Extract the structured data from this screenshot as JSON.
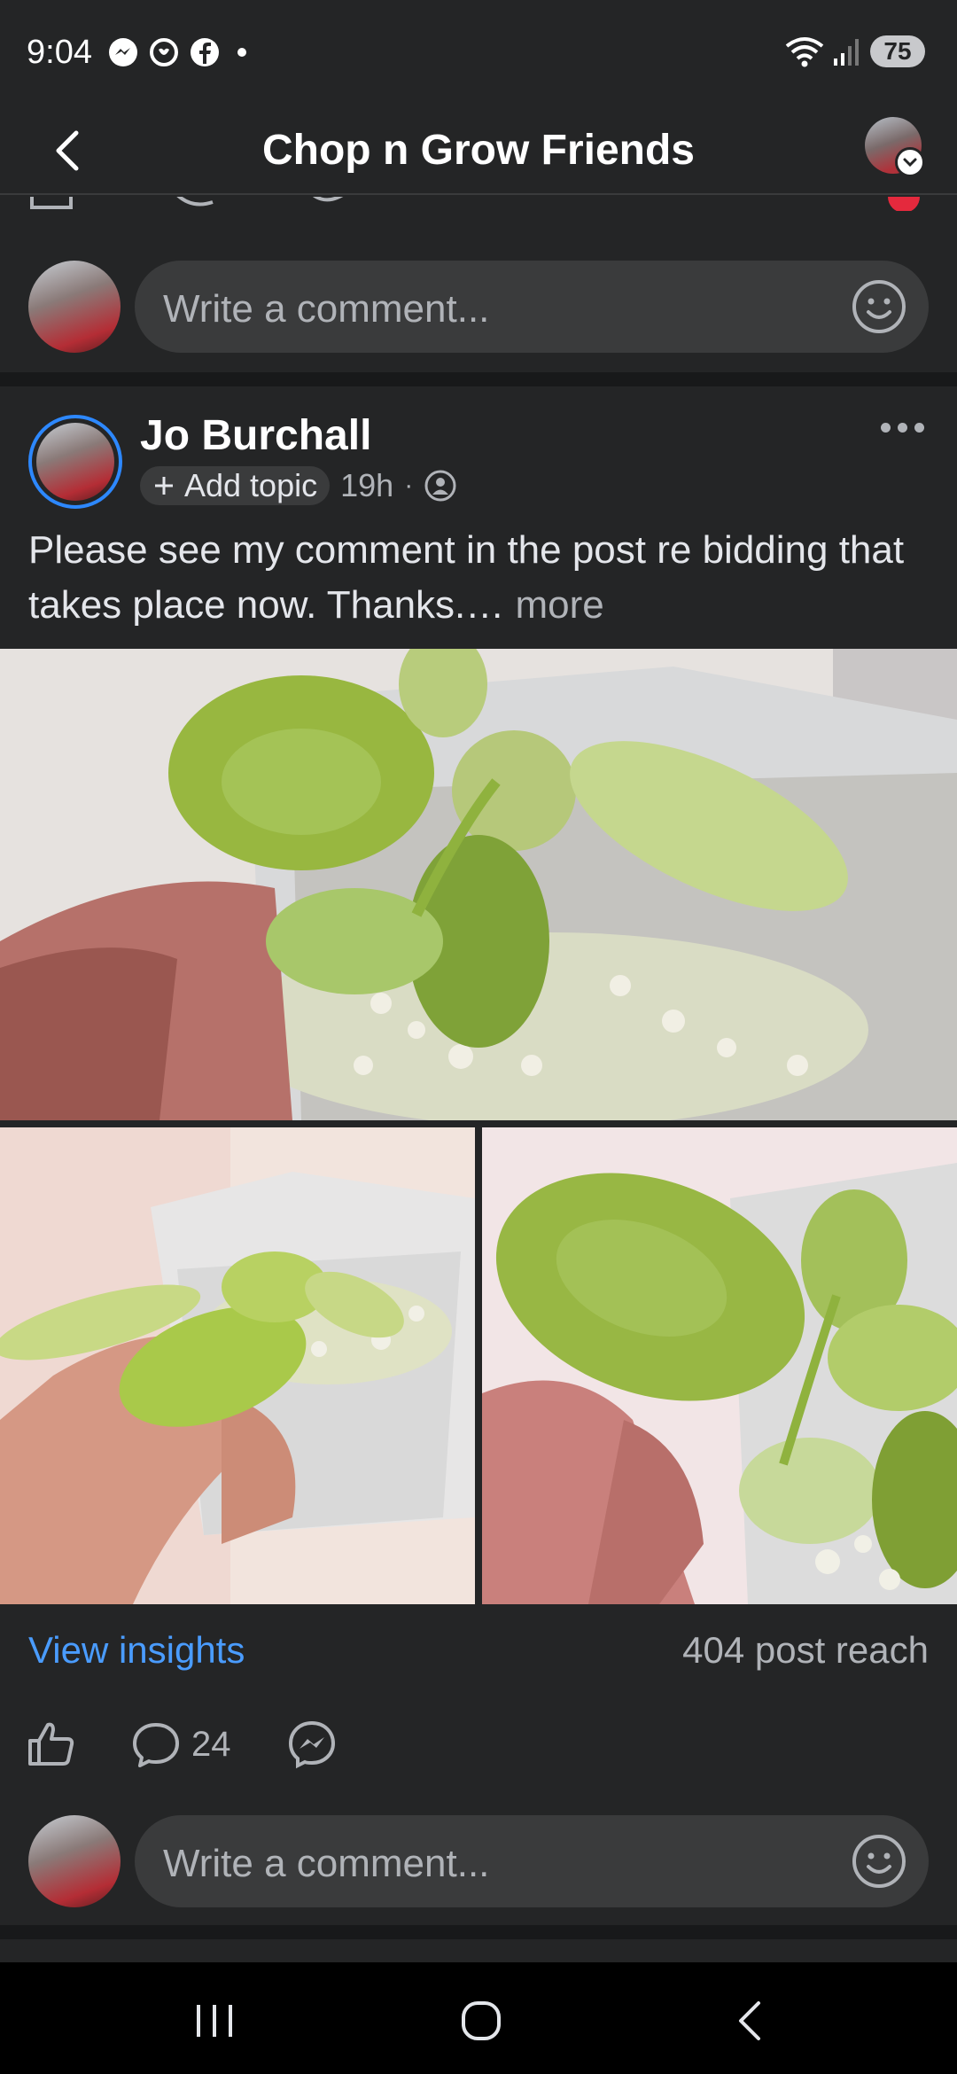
{
  "status_bar": {
    "time": "9:04",
    "battery": "75",
    "icons_left": [
      "messenger-icon",
      "notification-icon",
      "facebook-icon",
      "dot"
    ],
    "icons_right": [
      "wifi-icon",
      "signal-icon",
      "battery-icon"
    ]
  },
  "header": {
    "title": "Chop n Grow Friends"
  },
  "comment_box_1": {
    "placeholder": "Write a comment..."
  },
  "post": {
    "author": "Jo Burchall",
    "add_topic": "Add topic",
    "time": "19h",
    "separator": "·",
    "text": "Please see my comment in the post re bidding that takes place now. Thanks.…",
    "more": "more",
    "view_insights": "View insights",
    "post_reach": "404 post reach",
    "comment_count": "24"
  },
  "comment_box_2": {
    "placeholder": "Write a comment..."
  },
  "colors": {
    "background": "#242526",
    "divider": "#18191a",
    "link_blue": "#4a9cff",
    "avatar_ring": "#2d88ff"
  }
}
